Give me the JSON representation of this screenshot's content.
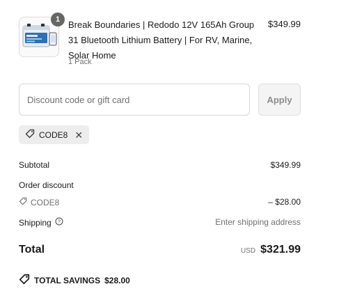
{
  "product": {
    "quantity_badge": "1",
    "title": "Break Boundaries | Redodo 12V 165Ah Group 31 Bluetooth Lithium Battery | For RV, Marine, Solar Home",
    "variant": "1 Pack",
    "price": "$349.99",
    "image_icon": "battery-product-image"
  },
  "discount": {
    "placeholder": "Discount code or gift card",
    "value": "",
    "apply_label": "Apply"
  },
  "applied_code": {
    "code": "CODE8",
    "tag_icon": "tag-icon",
    "remove_icon": "close-icon"
  },
  "summary": {
    "subtotal_label": "Subtotal",
    "subtotal_value": "$349.99",
    "order_discount_label": "Order discount",
    "discount_code": "CODE8",
    "discount_value": "– $28.00",
    "shipping_label": "Shipping",
    "shipping_value": "Enter shipping address",
    "total_label": "Total",
    "total_currency": "USD",
    "total_value": "$321.99",
    "savings_label": "TOTAL SAVINGS",
    "savings_value": "$28.00"
  },
  "colors": {
    "badge": "#666666",
    "chip_bg": "#ededed",
    "muted_text": "#707070",
    "battery_blue": "#2f6fb8"
  }
}
